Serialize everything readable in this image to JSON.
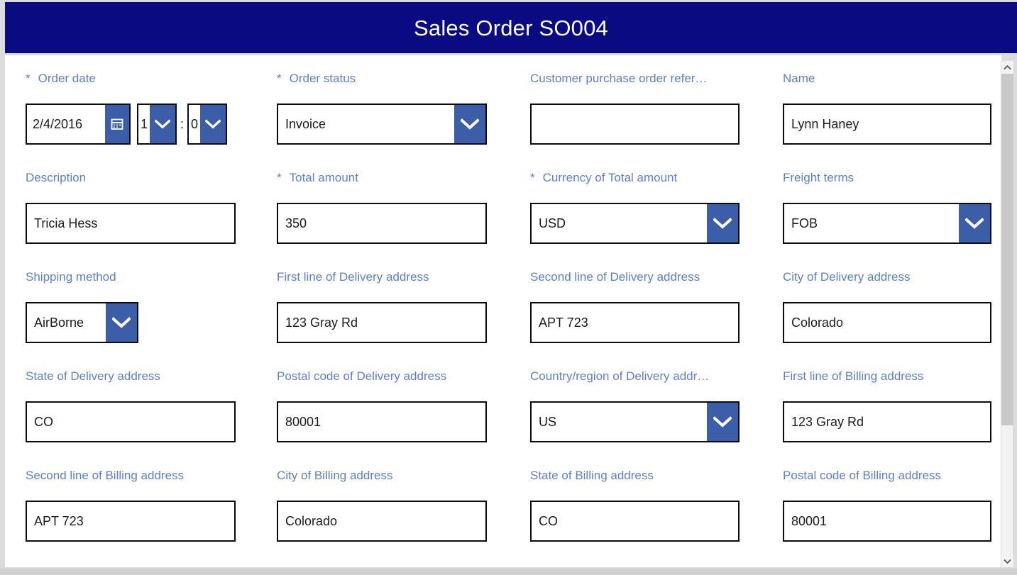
{
  "header": {
    "title": "Sales Order SO004",
    "background_color": "#0a0a82",
    "text_color": "#ffffff"
  },
  "theme": {
    "label_color": "#5f7fc8",
    "accent_button_color": "#3c5ea8",
    "field_border_color": "#0c0c0c",
    "surface_color": "#ffffff",
    "page_background": "#dcdcdc"
  },
  "icons": {
    "calendar": "calendar-icon",
    "chevron_down": "chevron-down-icon",
    "scroll_up": "scroll-up-arrow-icon",
    "scroll_down": "scroll-down-arrow-icon"
  },
  "required_marker": "*",
  "time_separator": ":",
  "form": {
    "rows": [
      {
        "fields": [
          {
            "name": "order-date",
            "label": "Order date",
            "required": true,
            "type": "datetime",
            "date_value": "2/4/2016",
            "hour_value": "1",
            "minute_value": "0"
          },
          {
            "name": "order-status",
            "label": "Order status",
            "required": true,
            "type": "combo",
            "value": "Invoice"
          },
          {
            "name": "customer-purchase-order-reference",
            "label": "Customer purchase order refer…",
            "required": false,
            "type": "text",
            "value": ""
          },
          {
            "name": "name",
            "label": "Name",
            "required": false,
            "type": "text",
            "value": "Lynn Haney"
          }
        ]
      },
      {
        "fields": [
          {
            "name": "description",
            "label": "Description",
            "required": false,
            "type": "text",
            "value": "Tricia Hess"
          },
          {
            "name": "total-amount",
            "label": "Total amount",
            "required": true,
            "type": "text",
            "value": "350"
          },
          {
            "name": "currency-of-total-amount",
            "label": "Currency of Total amount",
            "required": true,
            "type": "combo",
            "value": "USD"
          },
          {
            "name": "freight-terms",
            "label": "Freight terms",
            "required": false,
            "type": "combo",
            "value": "FOB"
          }
        ]
      },
      {
        "fields": [
          {
            "name": "shipping-method",
            "label": "Shipping method",
            "required": false,
            "type": "combo",
            "value": "AirBorne"
          },
          {
            "name": "first-line-of-delivery-address",
            "label": "First line of Delivery address",
            "required": false,
            "type": "text",
            "value": "123 Gray Rd"
          },
          {
            "name": "second-line-of-delivery-address",
            "label": "Second line of Delivery address",
            "required": false,
            "type": "text",
            "value": "APT 723"
          },
          {
            "name": "city-of-delivery-address",
            "label": "City of Delivery address",
            "required": false,
            "type": "text",
            "value": "Colorado"
          }
        ]
      },
      {
        "fields": [
          {
            "name": "state-of-delivery-address",
            "label": "State of Delivery address",
            "required": false,
            "type": "text",
            "value": "CO"
          },
          {
            "name": "postal-code-of-delivery-address",
            "label": "Postal code of Delivery address",
            "required": false,
            "type": "text",
            "value": "80001"
          },
          {
            "name": "country-region-of-delivery-address",
            "label": "Country/region of Delivery addr…",
            "required": false,
            "type": "combo",
            "value": "US"
          },
          {
            "name": "first-line-of-billing-address",
            "label": "First line of Billing address",
            "required": false,
            "type": "text",
            "value": "123 Gray Rd"
          }
        ]
      },
      {
        "fields": [
          {
            "name": "second-line-of-billing-address",
            "label": "Second line of Billing address",
            "required": false,
            "type": "text",
            "value": "APT 723"
          },
          {
            "name": "city-of-billing-address",
            "label": "City of Billing address",
            "required": false,
            "type": "text",
            "value": "Colorado"
          },
          {
            "name": "state-of-billing-address",
            "label": "State of Billing address",
            "required": false,
            "type": "text",
            "value": "CO"
          },
          {
            "name": "postal-code-of-billing-address",
            "label": "Postal code of Billing address",
            "required": false,
            "type": "text",
            "value": "80001"
          }
        ]
      }
    ]
  }
}
